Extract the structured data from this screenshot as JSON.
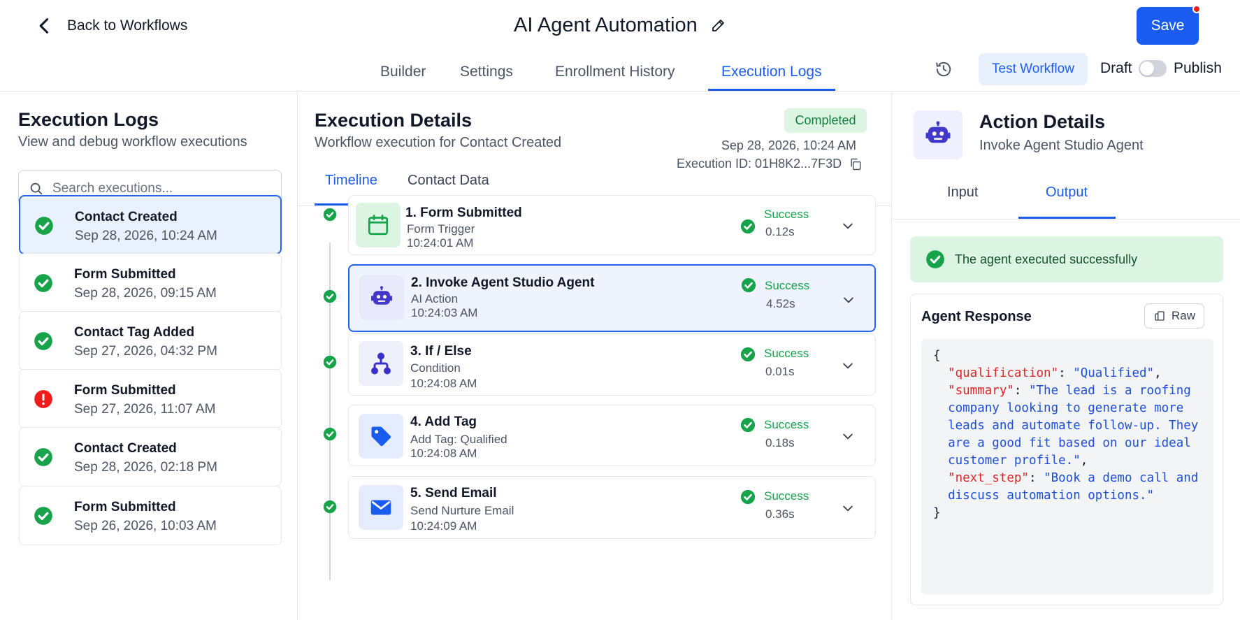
{
  "header": {
    "back_label": "Back to Workflows",
    "title": "AI Agent Automation",
    "save_label": "Save"
  },
  "nav": {
    "tabs": [
      {
        "label": "Builder"
      },
      {
        "label": "Settings"
      },
      {
        "label": "Enrollment History"
      },
      {
        "label": "Execution Logs",
        "active": true
      }
    ],
    "test_label": "Test Workflow",
    "draft_label": "Draft",
    "publish_label": "Publish",
    "publish_on": false
  },
  "left": {
    "title": "Execution Logs",
    "subtitle": "View and debug workflow executions",
    "search_placeholder": "Search executions...",
    "items": [
      {
        "title": "Contact Created",
        "date": "Sep 28, 2026, 10:24 AM",
        "status": "success",
        "selected": true
      },
      {
        "title": "Form Submitted",
        "date": "Sep 28, 2026, 09:15 AM",
        "status": "success"
      },
      {
        "title": "Contact Tag Added",
        "date": "Sep 27, 2026, 04:32 PM",
        "status": "success"
      },
      {
        "title": "Form Submitted",
        "date": "Sep 27, 2026, 11:07 AM",
        "status": "error"
      },
      {
        "title": "Contact Created",
        "date": "Sep 28, 2026, 02:18 PM",
        "status": "success"
      },
      {
        "title": "Form Submitted",
        "date": "Sep 26, 2026, 10:03 AM",
        "status": "success"
      }
    ]
  },
  "middle": {
    "title": "Execution Details",
    "subtitle": "Workflow execution for Contact Created",
    "status_badge": "Completed",
    "date": "Sep 28, 2026, 10:24 AM",
    "execution_id": "Execution ID: 01H8K2...7F3D",
    "tabs": [
      {
        "label": "Timeline",
        "active": true
      },
      {
        "label": "Contact Data"
      }
    ],
    "steps": [
      {
        "title": "1. Form Submitted",
        "type": "Form Trigger",
        "time": "10:24:01 AM",
        "status": "Success",
        "duration": "0.12s",
        "icon": "calendar-icon"
      },
      {
        "title": "2. Invoke Agent Studio Agent",
        "type": "AI Action",
        "time": "10:24:03 AM",
        "status": "Success",
        "duration": "4.52s",
        "icon": "robot-icon",
        "selected": true
      },
      {
        "title": "3. If / Else",
        "type": "Condition",
        "time": "10:24:08 AM",
        "status": "Success",
        "duration": "0.01s",
        "icon": "branch-icon"
      },
      {
        "title": "4. Add Tag",
        "type": "Add Tag: Qualified",
        "time": "10:24:08 AM",
        "status": "Success",
        "duration": "0.18s",
        "icon": "tag-icon"
      },
      {
        "title": "5. Send Email",
        "type": "Send Nurture Email",
        "time": "10:24:09 AM",
        "status": "Success",
        "duration": "0.36s",
        "icon": "mail-icon"
      }
    ]
  },
  "right": {
    "title": "Action Details",
    "subtitle": "Invoke Agent Studio Agent",
    "tabs": [
      {
        "label": "Input"
      },
      {
        "label": "Output",
        "active": true
      }
    ],
    "success_message": "The agent executed successfully",
    "response_title": "Agent Response",
    "raw_label": "Raw",
    "response": {
      "open": "{",
      "close": "}",
      "lines": [
        {
          "key": "\"qualification\"",
          "sep": ": ",
          "value": "\"Qualified\"",
          "tail": ","
        },
        {
          "key": "\"summary\"",
          "sep": ": ",
          "value": "\"The lead is a roofing",
          "tail": ""
        },
        {
          "key": "",
          "sep": "",
          "value": "company looking to generate more",
          "tail": ""
        },
        {
          "key": "",
          "sep": "",
          "value": "leads and automate follow-up. They",
          "tail": ""
        },
        {
          "key": "",
          "sep": "",
          "value": "are a good fit based on our ideal",
          "tail": ""
        },
        {
          "key": "",
          "sep": "",
          "value": "customer profile.\"",
          "tail": ","
        },
        {
          "key": "\"next_step\"",
          "sep": ": ",
          "value": "\"Book a demo call and",
          "tail": ""
        },
        {
          "key": "",
          "sep": "",
          "value": "discuss automation options.\"",
          "tail": ""
        }
      ]
    }
  },
  "colors": {
    "accent": "#1a5bf0",
    "success": "#16a34a",
    "error": "#ef1c1c",
    "selected_bg": "#eaf1fe"
  }
}
